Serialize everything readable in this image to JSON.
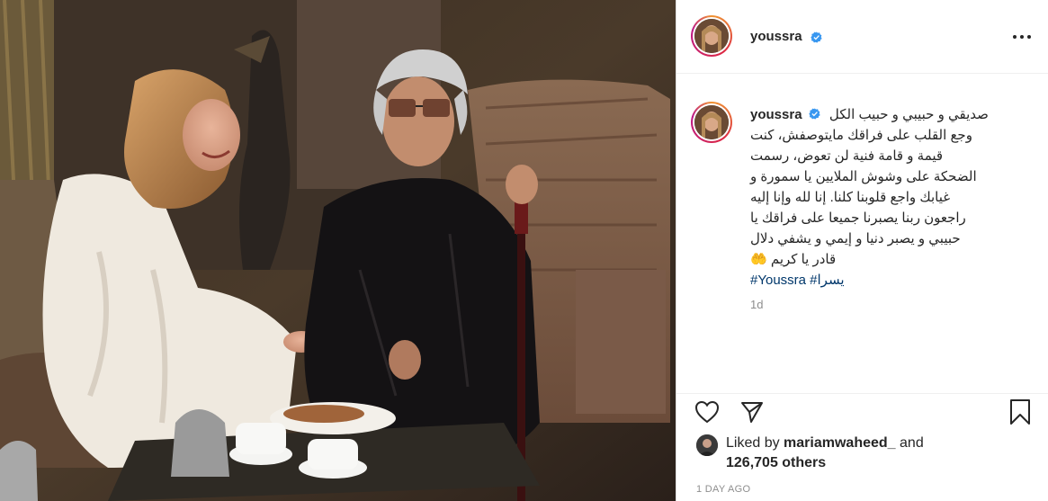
{
  "post": {
    "username": "youssra",
    "verified": true,
    "more_icon": "more-horizontal-icon",
    "image_alt": "Youssra in a white dress laughing with an older man in glasses holding a cane, seated in an ornate room"
  },
  "caption": {
    "username": "youssra",
    "lines": [
      "صديقي و حبيبي و حبيب الكل",
      "وجع القلب على فراقك مايتوصفش، كنت",
      "قيمة و قامة فنية لن تعوض، رسمت",
      "الضحكة على وشوش الملايين يا سمورة و",
      "غيابك واجع قلوبنا كلنا. إنا لله وإنا إليه",
      "راجعون ربنا يصبرنا جميعا على فراقك يا",
      "حبيبي و يصبر دنيا و إيمي و يشفي دلال",
      "قادر يا كريم 🤲"
    ],
    "hashtags": "#Youssra #يسرا",
    "age": "1d"
  },
  "actions": {
    "like_icon": "heart-icon",
    "share_icon": "paper-plane-icon",
    "save_icon": "bookmark-icon"
  },
  "likes": {
    "prefix": "Liked by",
    "user": "mariamwaheed_",
    "connector": "and",
    "others": "126,705 others"
  },
  "timestamp": "1 DAY AGO",
  "colors": {
    "verified_blue": "#3897f0",
    "hashtag": "#00376b",
    "muted": "#8e8e8e"
  }
}
